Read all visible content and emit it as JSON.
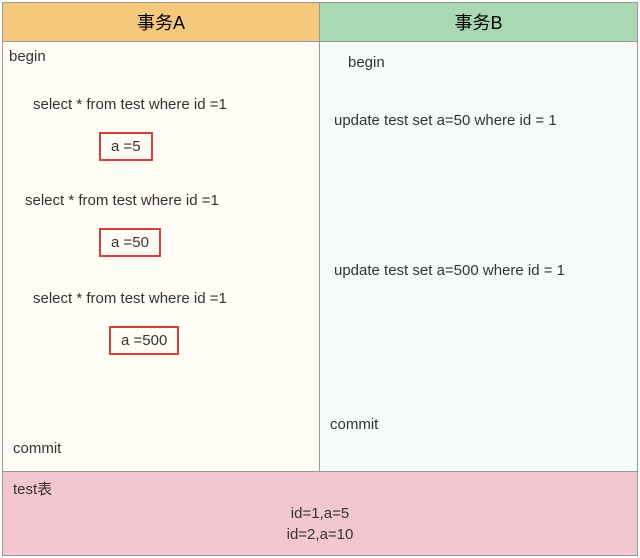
{
  "headers": {
    "a": "事务A",
    "b": "事务B"
  },
  "transA": {
    "begin": "begin",
    "select1": "select * from test where id =1",
    "result1": "a =5",
    "select2": "select * from test where id =1",
    "result2": "a =50",
    "select3": "select * from test where id =1",
    "result3": "a =500",
    "commit": "commit"
  },
  "transB": {
    "begin": "begin",
    "update1": "update test set a=50 where id = 1",
    "update2": "update test set a=500 where id = 1",
    "commit": "commit"
  },
  "footer": {
    "title": "test表",
    "row1": "id=1,a=5",
    "row2": "id=2,a=10"
  }
}
